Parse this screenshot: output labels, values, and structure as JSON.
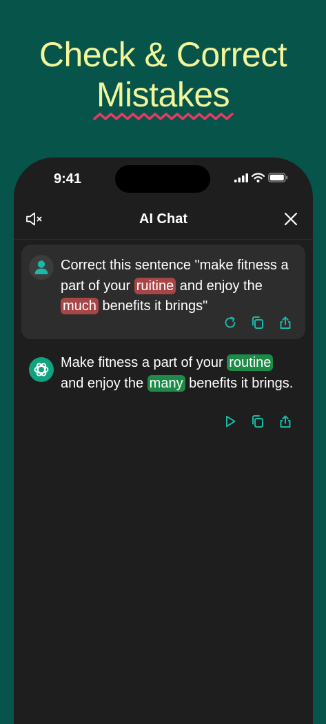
{
  "headline": {
    "line1": "Check & Correct",
    "line2": "Mistakes"
  },
  "status": {
    "time": "9:41"
  },
  "header": {
    "title": "AI Chat"
  },
  "user_message": {
    "t1": "Correct this sentence \"make fitness a part of your ",
    "err1": "ruitine",
    "t2": " and enjoy the ",
    "err2": "much",
    "t3": " benefits it brings\""
  },
  "ai_message": {
    "t1": "Make fitness a part of your ",
    "fix1": "routine",
    "t2": " and enjoy the ",
    "fix2": "many",
    "t3": " benefits it brings."
  },
  "colors": {
    "background": "#06544a",
    "headline": "#f3f59a",
    "accent": "#19b8a8",
    "error_highlight": "#a84646",
    "fix_highlight": "#1d8a47"
  },
  "icons": [
    "mute-icon",
    "close-icon",
    "user-avatar-icon",
    "ai-logo-icon",
    "regenerate-icon",
    "copy-icon",
    "share-icon",
    "play-icon"
  ]
}
